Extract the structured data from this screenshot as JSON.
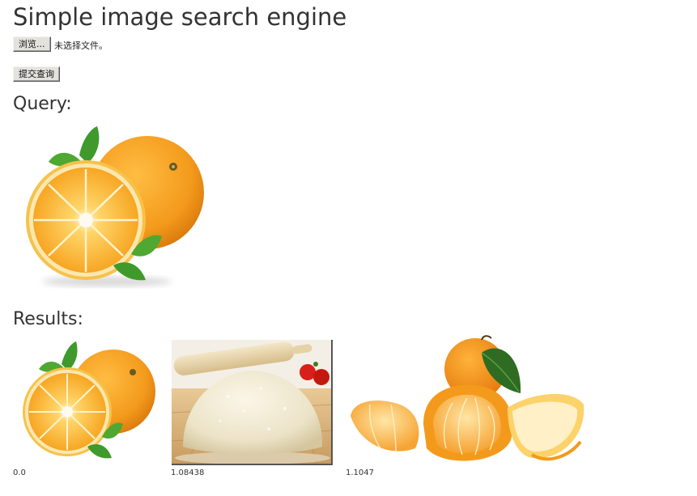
{
  "header": {
    "title": "Simple image search engine"
  },
  "upload": {
    "browse_label": "浏览...",
    "file_status": "未选择文件。",
    "submit_label": "提交查询"
  },
  "query": {
    "heading": "Query:",
    "image_icon": "orange-with-half-slice-image"
  },
  "results": {
    "heading": "Results:",
    "items": [
      {
        "image_icon": "orange-with-half-slice-image",
        "score": "0.0"
      },
      {
        "image_icon": "dough-with-rolling-pin-image",
        "score": "1.08438"
      },
      {
        "image_icon": "peeled-tangerine-image",
        "score": "1.1047"
      }
    ]
  },
  "colors": {
    "orange": "#f39a1c",
    "orange_light": "#fcd36a",
    "leaf": "#3f9a2b",
    "dough": "#ece3c7",
    "wood": "#c89a5e",
    "tomato": "#d8201a"
  }
}
